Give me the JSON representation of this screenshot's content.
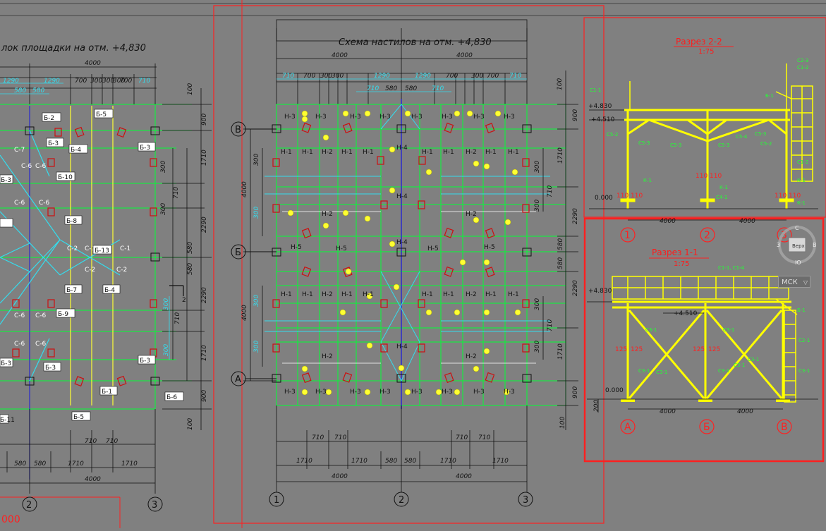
{
  "colors": {
    "background": "#808080",
    "frame": "#ff0000",
    "beam": "#00ff33",
    "dim": "#111111",
    "yellow": "#ffff00",
    "cyan": "#33ddee",
    "blue": "#2a2acc"
  },
  "left_plan": {
    "title": "лок площадки на отм. +4,830",
    "dims_top": [
      "4000",
      "1290",
      "1290",
      "580",
      "580",
      "700",
      "300",
      "300",
      "300",
      "700",
      "710"
    ],
    "dims_bottom": [
      "580",
      "580",
      "1710",
      "1710",
      "710",
      "710",
      "4000"
    ],
    "dims_right": [
      "100",
      "900",
      "1710",
      "300",
      "710",
      "300",
      "2290",
      "580",
      "580",
      "300",
      "710",
      "300",
      "1710",
      "900",
      "100"
    ],
    "beams": [
      "Б-2",
      "Б-5",
      "Б-3",
      "Б-4",
      "Б-3",
      "Б-10",
      "Б-3",
      "Б-8",
      "Б-13",
      "Б-7",
      "Б-4",
      "Б-9",
      "Б-3",
      "Б-3",
      "Б-1",
      "Б-6",
      "Б-5",
      "Б-11"
    ],
    "axes": [
      "2",
      "3"
    ],
    "stamp": "000",
    "marker": "2"
  },
  "center_plan": {
    "title": "Схема настилов на отм. +4,830",
    "dims_top": [
      "4000",
      "4000",
      "710",
      "700",
      "300",
      "300",
      "1290",
      "1290",
      "700",
      "300",
      "700",
      "710",
      "710",
      "580",
      "580",
      "710"
    ],
    "dims_bottom": [
      "710",
      "710",
      "710",
      "710",
      "1710",
      "1710",
      "580",
      "580",
      "1710",
      "1710",
      "4000",
      "4000"
    ],
    "dims_right": [
      "100",
      "900",
      "1710",
      "300",
      "710",
      "300",
      "2290",
      "580",
      "580",
      "2290",
      "300",
      "710",
      "300",
      "1710",
      "900",
      "100"
    ],
    "dims_left": [
      "4000",
      "4000",
      "300",
      "300",
      "300",
      "300"
    ],
    "row_axes": [
      "В",
      "Б",
      "А"
    ],
    "col_axes": [
      "1",
      "2",
      "3"
    ],
    "panels": {
      "n3": "Н-3",
      "n1": "Н-1",
      "n2": "Н-2",
      "n4": "Н-4",
      "n5": "Н-5"
    }
  },
  "section_2_2": {
    "title": "Разрез 2-2",
    "scale": "1:75",
    "levels": [
      "+4.830",
      "+4.510",
      "0.000"
    ],
    "dims": [
      "4000",
      "4000",
      "110",
      "110"
    ],
    "axes": [
      "1",
      "2",
      "3"
    ]
  },
  "section_1_1": {
    "title": "Разрез 1-1",
    "scale": "1:75",
    "levels": [
      "+4.830",
      "+4.510",
      "0.000"
    ],
    "dims": [
      "4000",
      "4000",
      "125",
      "125",
      "125",
      "125",
      "200"
    ],
    "axes": [
      "А",
      "Б",
      "В"
    ]
  },
  "viewcube": {
    "label": "Верх",
    "compass_n": "С",
    "compass_s": "Ю",
    "compass_w": "З",
    "compass_e": "В"
  },
  "ucs": {
    "label": "МСК"
  }
}
